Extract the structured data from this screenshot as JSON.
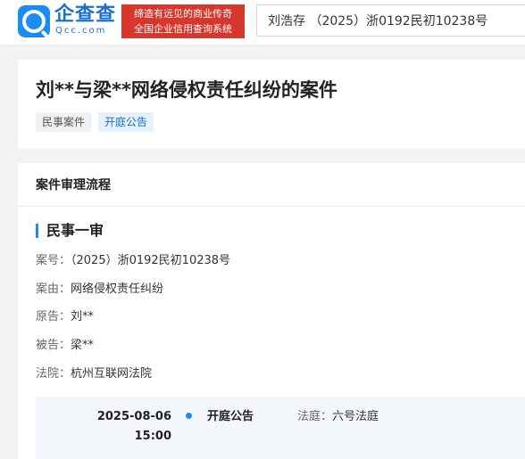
{
  "header": {
    "logo_text": "企查查",
    "logo_sub": "Qcc.com",
    "slogan_line1": "缔造有远见的商业传奇",
    "slogan_line2": "全国企业信用查询系统",
    "search_value": "刘浩存 （2025）浙0192民初10238号"
  },
  "case": {
    "title": "刘**与梁**网络侵权责任纠纷的案件",
    "tags": [
      "民事案件",
      "开庭公告"
    ]
  },
  "process": {
    "section_title": "案件审理流程",
    "stage_title": "民事一审",
    "fields": [
      {
        "label": "案号：",
        "value": "（2025）浙0192民初10238号"
      },
      {
        "label": "案由：",
        "value": "网络侵权责任纠纷"
      },
      {
        "label": "原告：",
        "value": "刘**"
      },
      {
        "label": "被告：",
        "value": "梁**"
      },
      {
        "label": "法院：",
        "value": "杭州互联网法院"
      }
    ],
    "timeline": [
      {
        "date": "2025-08-06",
        "time": "15:00",
        "event": "开庭公告",
        "court_label": "法庭：",
        "court_value": "六号法庭"
      }
    ]
  },
  "colors": {
    "accent": "#1b8cf2",
    "slogan_bg": "#d6362c",
    "tag_notice_bg": "#e6f2fd"
  }
}
